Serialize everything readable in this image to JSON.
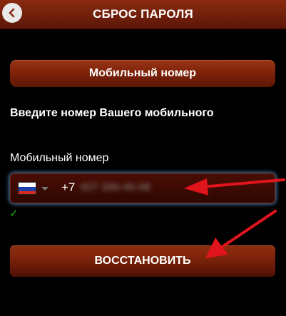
{
  "header": {
    "title": "СБРОС ПАРОЛЯ",
    "back_icon": "chevron-left-icon"
  },
  "mode_button": {
    "label": "Мобильный номер"
  },
  "form": {
    "instruction": "Введите номер Вашего мобильного",
    "phone_label": "Мобильный номер",
    "country_flag": "russia-flag-icon",
    "dial_code": "+7",
    "phone_value": "927 266-45-08",
    "valid_icon": "✓"
  },
  "submit_button": {
    "label": "ВОССТАНОВИТЬ"
  },
  "colors": {
    "background": "#000000",
    "header": "#7a2209",
    "button": "#7c2209",
    "check": "#1fb51f",
    "annotation_arrow": "#e0141b",
    "focus_glow": "#78beff"
  }
}
